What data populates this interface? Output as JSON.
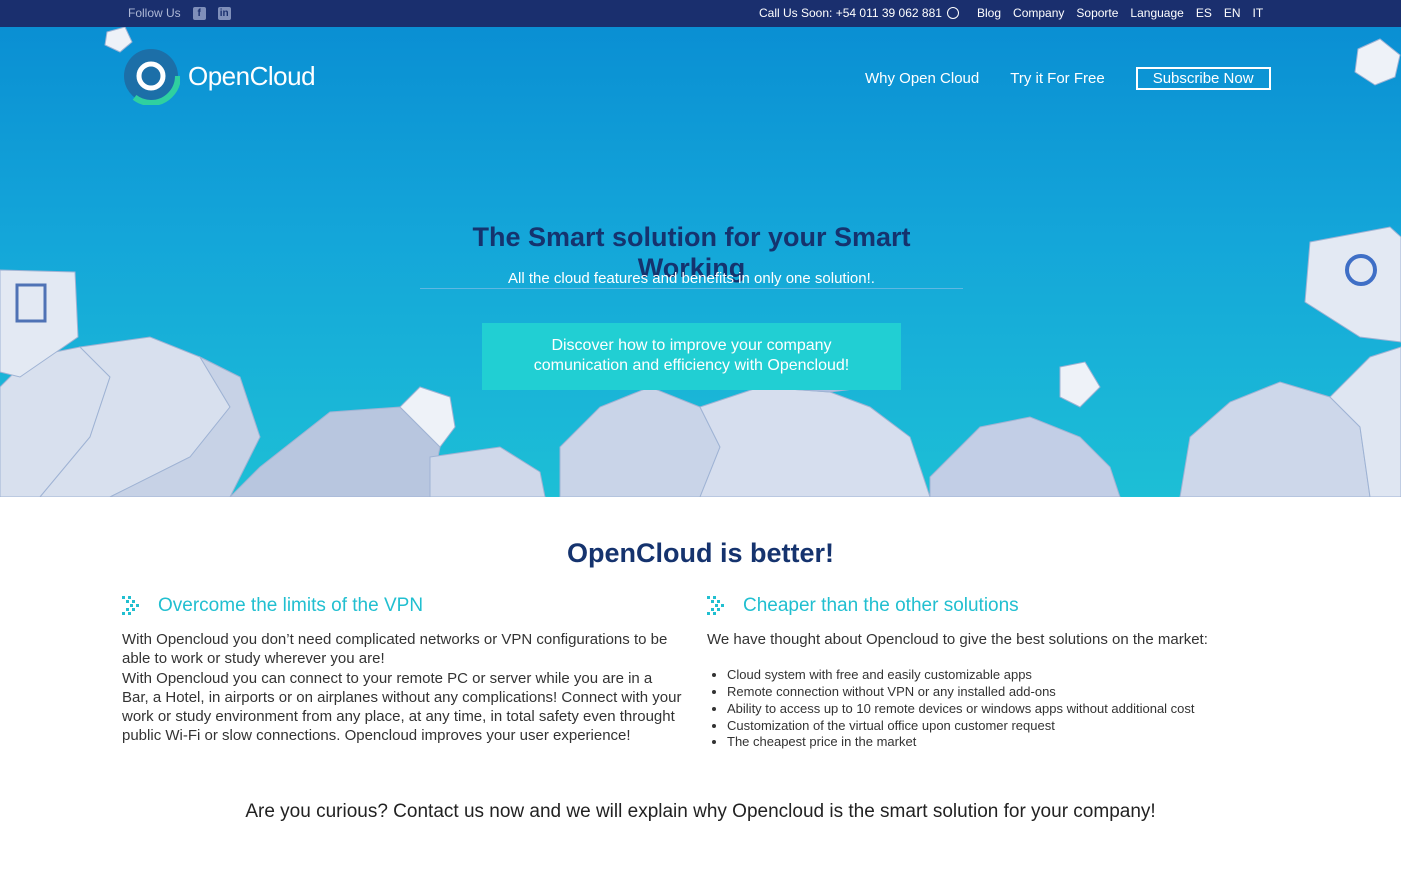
{
  "topbar": {
    "follow_label": "Follow Us",
    "social_icons": [
      "facebook-icon",
      "linkedin-icon"
    ],
    "call_label": "Call Us Soon: +54 011 39 062 881",
    "links": [
      "Blog",
      "Company",
      "Soporte",
      "Language",
      "ES",
      "EN",
      "IT"
    ]
  },
  "header": {
    "logo_text": "OpenCloud",
    "nav": [
      "Why Open Cloud",
      "Try it For Free"
    ],
    "subscribe_label": "Subscribe Now"
  },
  "hero": {
    "title": "The Smart solution for your Smart Working",
    "subtitle": "All the cloud features and benefits in only one solution!.",
    "cta_line1": "Discover how to improve your company",
    "cta_line2": "comunication and efficiency with Opencloud!"
  },
  "main": {
    "title": "OpenCloud is better!",
    "left": {
      "heading": "Overcome the limits of the VPN",
      "p1": "With Opencloud you don’t need complicated networks or VPN configurations to be able to work or study wherever you are!",
      "p2": "With Opencloud you can connect to your remote PC or server while you are in a Bar, a Hotel, in airports or on airplanes without any complications! Connect with your work or study environment from any place, at any time, in total safety even throught public Wi-Fi or slow connections. Opencloud improves your user experience!"
    },
    "right": {
      "heading": "Cheaper than the other solutions",
      "intro": "We have thought about Opencloud to give the best solutions on the market:",
      "bullets": [
        "Cloud system with free and easily customizable apps",
        "Remote connection without VPN or any installed add-ons",
        "Ability to access up to 10 remote devices or windows apps without additional cost",
        "Customization of the virtual office upon customer request",
        "The cheapest price in the market"
      ]
    },
    "bottom_cta": "Are you curious? Contact us now and we will explain why Opencloud is the smart solution for your company!"
  },
  "colors": {
    "topbar": "#1a2f6e",
    "hero_top": "#0a8fd3",
    "hero_bottom": "#1dbfd6",
    "accent": "#21bfd0",
    "title": "#15336e",
    "cta": "#21cfd3"
  }
}
